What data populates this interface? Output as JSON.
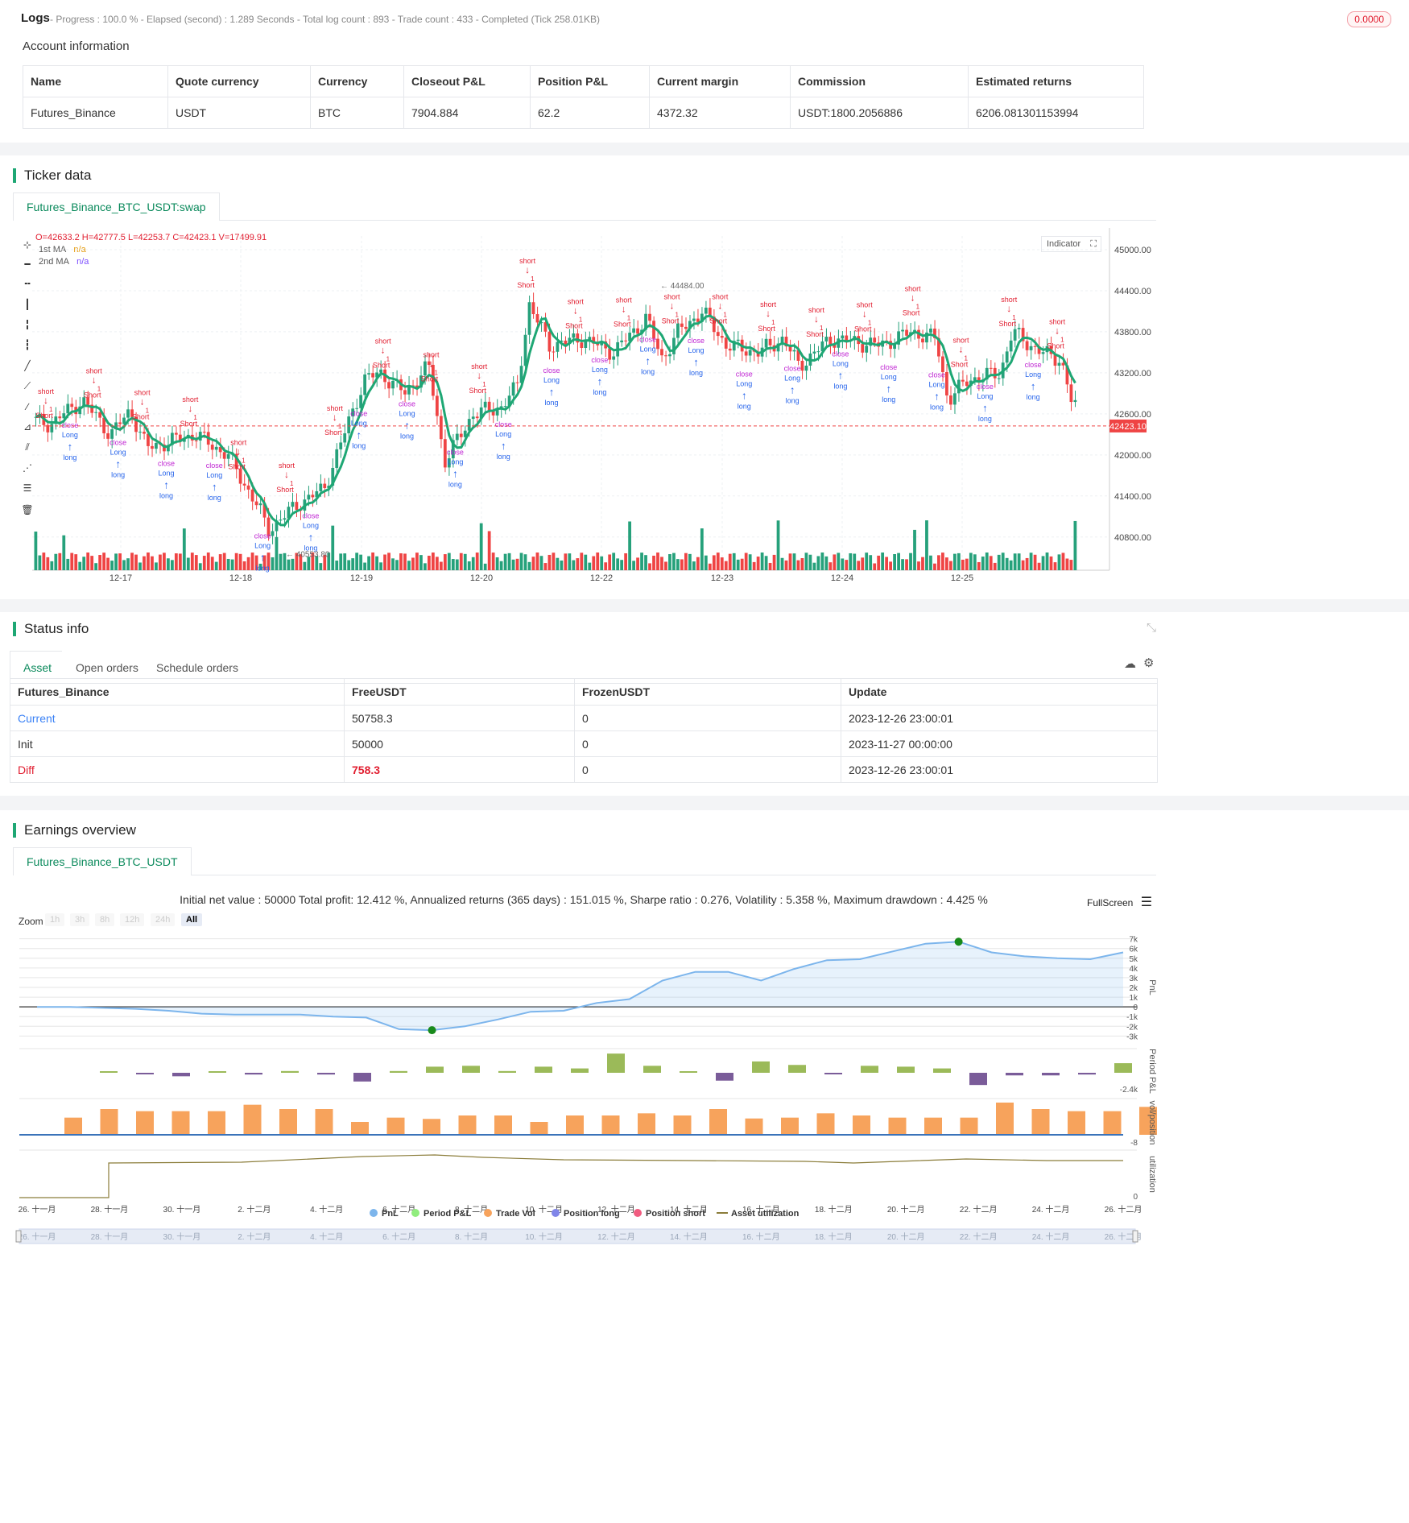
{
  "logs": {
    "title": "Logs",
    "status": "- Progress : 100.0 % - Elapsed (second) : 1.289  Seconds - Total log count : 893 - Trade count : 433 - Completed (Tick 258.01KB)",
    "badge": "0.0000"
  },
  "account": {
    "title": "Account information",
    "columns": [
      "Name",
      "Quote currency",
      "Currency",
      "Closeout P&L",
      "Position P&L",
      "Current margin",
      "Commission",
      "Estimated returns"
    ],
    "row": [
      "Futures_Binance",
      "USDT",
      "BTC",
      "7904.884",
      "62.2",
      "4372.32",
      "USDT:1800.2056886",
      "6206.081301153994"
    ]
  },
  "ticker": {
    "title": "Ticker data",
    "tab": "Futures_Binance_BTC_USDT:swap",
    "ohlc": "O=42633.2 H=42777.5 L=42253.7 C=42423.1 V=17499.91",
    "ma1_label": "1st MA",
    "ma1_val": "n/a",
    "ma2_label": "2nd MA",
    "ma2_val": "n/a",
    "indicator_btn": "Indicator",
    "last_price": "42423.10",
    "hi_label": "44484.00",
    "lo_label": "40553.80",
    "y_ticks": [
      "45000.00",
      "44400.00",
      "43800.00",
      "43200.00",
      "42600.00",
      "42000.00",
      "41400.00",
      "40800.00"
    ],
    "x_ticks": [
      "12-17",
      "12-18",
      "12-19",
      "12-20",
      "12-22",
      "12-23",
      "12-24",
      "12-25"
    ],
    "colors": {
      "up": "#26a17b",
      "down": "#ef4444",
      "ma": "#1ea774",
      "short": "#e11d2f",
      "long": "#2563eb",
      "close": "#c026d3"
    },
    "marker_words": {
      "short": "short",
      "Short": "Short",
      "long": "long",
      "Long": "Long",
      "close": "close",
      "one": "1"
    }
  },
  "status": {
    "title": "Status info",
    "tabs": [
      "Asset",
      "Open orders",
      "Schedule orders"
    ],
    "columns": [
      "Futures_Binance",
      "FreeUSDT",
      "FrozenUSDT",
      "Update"
    ],
    "rows": [
      [
        "Current",
        "50758.3",
        "0",
        "2023-12-26 23:00:01"
      ],
      [
        "Init",
        "50000",
        "0",
        "2023-11-27 00:00:00"
      ],
      [
        "Diff",
        "758.3",
        "0",
        "2023-12-26 23:00:01"
      ]
    ]
  },
  "earnings": {
    "title": "Earnings overview",
    "tab": "Futures_Binance_BTC_USDT",
    "summary": "Initial net value : 50000 Total profit: 12.412 %, Annualized returns (365 days) : 151.015 %, Sharpe ratio : 0.276, Volatility : 5.358 %, Maximum drawdown : 4.425 %",
    "fullscreen": "FullScreen",
    "zoom_label": "Zoom",
    "zoom_opts": [
      "1h",
      "3h",
      "8h",
      "12h",
      "24h",
      "All"
    ],
    "pnl_ticks": [
      "7k",
      "6k",
      "5k",
      "4k",
      "3k",
      "2k",
      "1k",
      "0",
      "-1k",
      "-2k",
      "-3k"
    ],
    "axis_titles": [
      "PnL",
      "Period P&L",
      "vol/position",
      "utilization"
    ],
    "period_min": "-2.4k",
    "vol_min": "-8",
    "util_zero": "0",
    "x_ticks": [
      "26. 十一月",
      "28. 十一月",
      "30. 十一月",
      "2. 十二月",
      "4. 十二月",
      "6. 十二月",
      "8. 十二月",
      "10. 十二月",
      "12. 十二月",
      "14. 十二月",
      "16. 十二月",
      "18. 十二月",
      "20. 十二月",
      "22. 十二月",
      "24. 十二月",
      "26. 十二月"
    ],
    "legend": [
      {
        "name": "PnL",
        "color": "#7cb5ec"
      },
      {
        "name": "Period P&L",
        "color": "#90ed7d"
      },
      {
        "name": "Trade Vol",
        "color": "#f7a35c"
      },
      {
        "name": "Position long",
        "color": "#8085e9"
      },
      {
        "name": "Position short",
        "color": "#f15c80"
      },
      {
        "name": "Asset utilization",
        "color": "#8b7d3a"
      }
    ],
    "pnl_series": [
      0,
      0,
      -100,
      -200,
      -400,
      -700,
      -800,
      -800,
      -800,
      -1000,
      -1100,
      -2300,
      -2400,
      -2000,
      -1300,
      -500,
      -400,
      400,
      800,
      2700,
      3600,
      3600,
      2700,
      3900,
      4800,
      4900,
      5700,
      6500,
      6700,
      5600,
      5200,
      5000,
      4900,
      5600
    ],
    "period_pnl": [
      0,
      -100,
      -400,
      0,
      -200,
      200,
      -200,
      -1000,
      200,
      700,
      800,
      200,
      700,
      500,
      2200,
      800,
      0,
      -900,
      1300,
      900,
      -100,
      800,
      700,
      500,
      -1400,
      -300,
      -300,
      -200,
      1100
    ],
    "trade_vol": [
      4,
      6,
      5.5,
      5.5,
      5.5,
      7,
      6,
      6,
      3,
      4,
      3.7,
      4.5,
      4.5,
      3,
      4.5,
      4.5,
      5,
      4.5,
      6,
      3.8,
      4,
      5,
      4.5,
      4,
      4,
      4,
      7.5,
      6,
      5.5,
      5.5,
      6.5
    ]
  }
}
